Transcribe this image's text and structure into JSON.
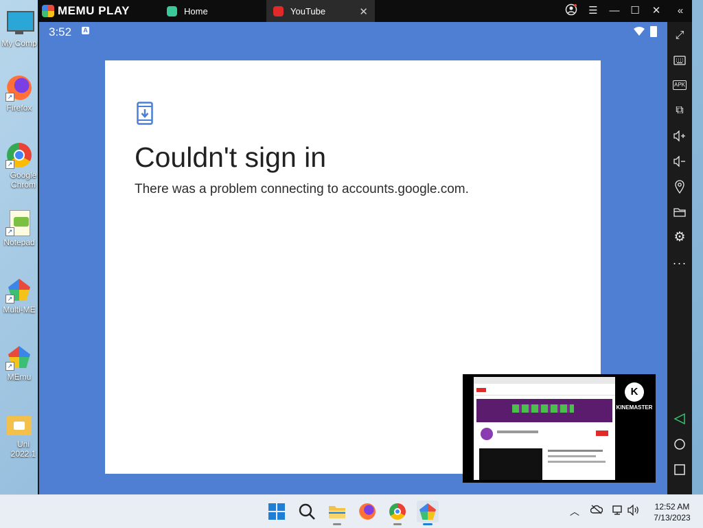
{
  "desktop": {
    "icons": [
      {
        "label": "My Comp"
      },
      {
        "label": "Firefox"
      },
      {
        "label": "Google Chrom"
      },
      {
        "label": "Notepad"
      },
      {
        "label": "Multi-ME"
      },
      {
        "label": "MEmu"
      },
      {
        "label": "Uni 2022.1"
      }
    ]
  },
  "emulator": {
    "brand": "MEMU PLAY",
    "tabs": [
      {
        "label": "Home"
      },
      {
        "label": "YouTube"
      }
    ]
  },
  "android": {
    "status_time": "3:52",
    "notification_badge": "A"
  },
  "dialog": {
    "title": "Couldn't sign in",
    "message": "There was a problem connecting to accounts.google.com."
  },
  "preview": {
    "brand": "KINEMASTER",
    "brand_letter": "K"
  },
  "sidebar_tools": [
    {
      "icon": "fullscreen-icon"
    },
    {
      "icon": "keyboard-icon"
    },
    {
      "icon": "apk-icon",
      "label": "APK"
    },
    {
      "icon": "add-window-icon"
    },
    {
      "icon": "volume-up-icon"
    },
    {
      "icon": "volume-down-icon"
    },
    {
      "icon": "location-icon"
    },
    {
      "icon": "folder-icon"
    },
    {
      "icon": "settings-icon"
    },
    {
      "icon": "more-icon"
    },
    {
      "icon": "back-icon"
    },
    {
      "icon": "home-icon"
    },
    {
      "icon": "recents-icon"
    }
  ],
  "taskbar": {
    "time": "12:52 AM",
    "date": "7/13/2023"
  },
  "colors": {
    "android_bg": "#4f7fd3",
    "accent_blue": "#4a7fd4",
    "youtube_red": "#e02a2a"
  }
}
